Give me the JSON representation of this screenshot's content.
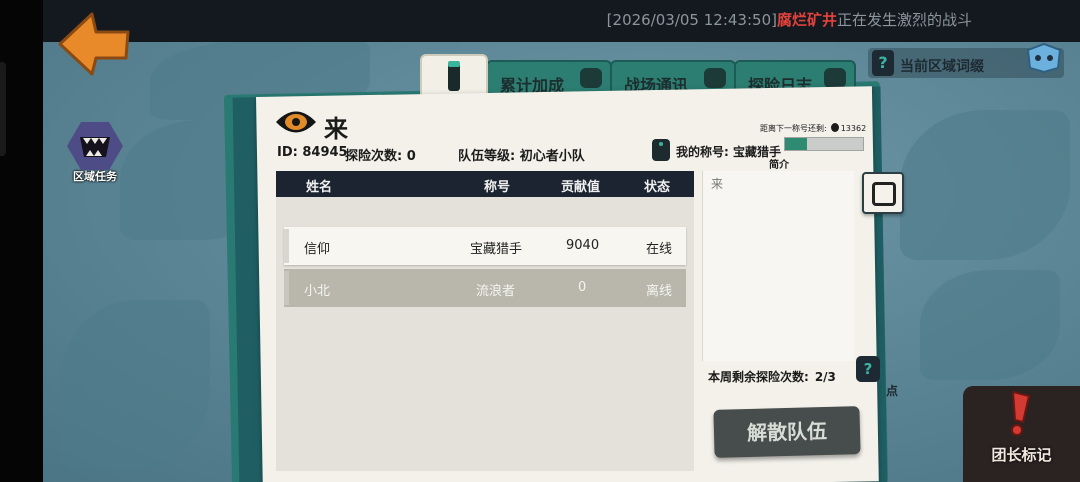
{
  "top_bar": {
    "news_time": "[2026/03/05 12:43:50]",
    "news_place": "腐烂矿井",
    "news_text": "正在发生激烈的战斗",
    "colors": {
      "bar": "#14191f",
      "place": "#e2423c",
      "text": "#8c949c"
    }
  },
  "buttons": {
    "back_icon": "orange-back-arrow-icon",
    "region_task": "区域任务",
    "current_region_words": "当前区域词缀",
    "question_mark": "?",
    "disband": "解散队伍",
    "leader_mark": "团长标记"
  },
  "tabs": [
    {
      "label": "",
      "icon": "info-icon",
      "active": true
    },
    {
      "label": "累计加成",
      "icon": "mask-icon",
      "active": false
    },
    {
      "label": "战场通讯",
      "icon": "chat-icon",
      "active": false
    },
    {
      "label": "探险日志",
      "icon": "edit-icon",
      "active": false
    }
  ],
  "team": {
    "name": "来",
    "id_label": "ID: 84945",
    "expedition_count_label": "探险次数: 0",
    "level_label": "队伍等级: 初心者小队",
    "next_title_label": "距离下一称号还剩:",
    "next_title_value": "13362",
    "my_title_label": "我的称号: 宝藏猎手",
    "my_title_progress": 0.28,
    "intro_label": "简介",
    "intro_text": "来"
  },
  "members": {
    "headers": [
      "姓名",
      "称号",
      "贡献值",
      "状态"
    ],
    "rows": [
      {
        "name": "信仰",
        "title": "宝藏猎手",
        "contribution": "9040",
        "status": "在线"
      },
      {
        "name": "小北",
        "title": "流浪者",
        "contribution": "0",
        "status": "离线"
      }
    ]
  },
  "weekly": {
    "label": "本周剩余探险次数:",
    "value": "2/3"
  },
  "side_deco": "点",
  "colors": {
    "paper": "#f3f1ea",
    "board": "#1f5f63",
    "tab": "#2c7d72",
    "accent_green": "#3ab59c",
    "table_header": "#1b2430"
  }
}
